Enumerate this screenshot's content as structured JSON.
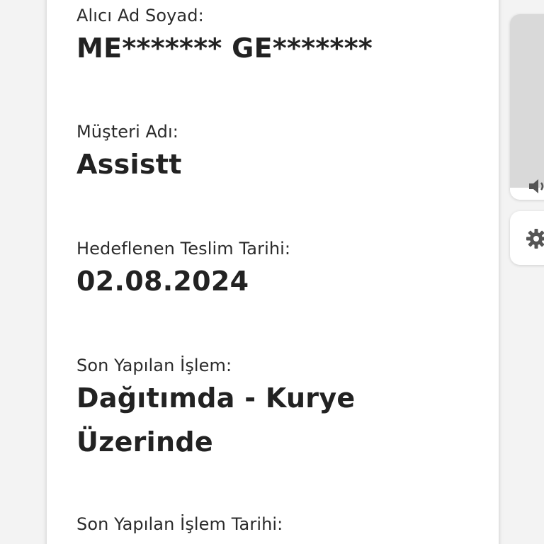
{
  "details": {
    "recipient_label": "Alıcı Ad Soyad:",
    "recipient_value": "ME******* GE*******",
    "customer_label": "Müşteri Adı:",
    "customer_value": "Assistt",
    "target_date_label": "Hedeflenen Teslim Tarihi:",
    "target_date_value": "02.08.2024",
    "last_action_label": "Son Yapılan İşlem:",
    "last_action_value_line1": "Dağıtımda - Kurye",
    "last_action_value_line2": "Üzerinde",
    "last_action_date_label": "Son Yapılan İşlem Tarihi:"
  },
  "side_controls": {
    "volume_icon": "speaker-icon",
    "settings_icon": "gear-icon"
  }
}
